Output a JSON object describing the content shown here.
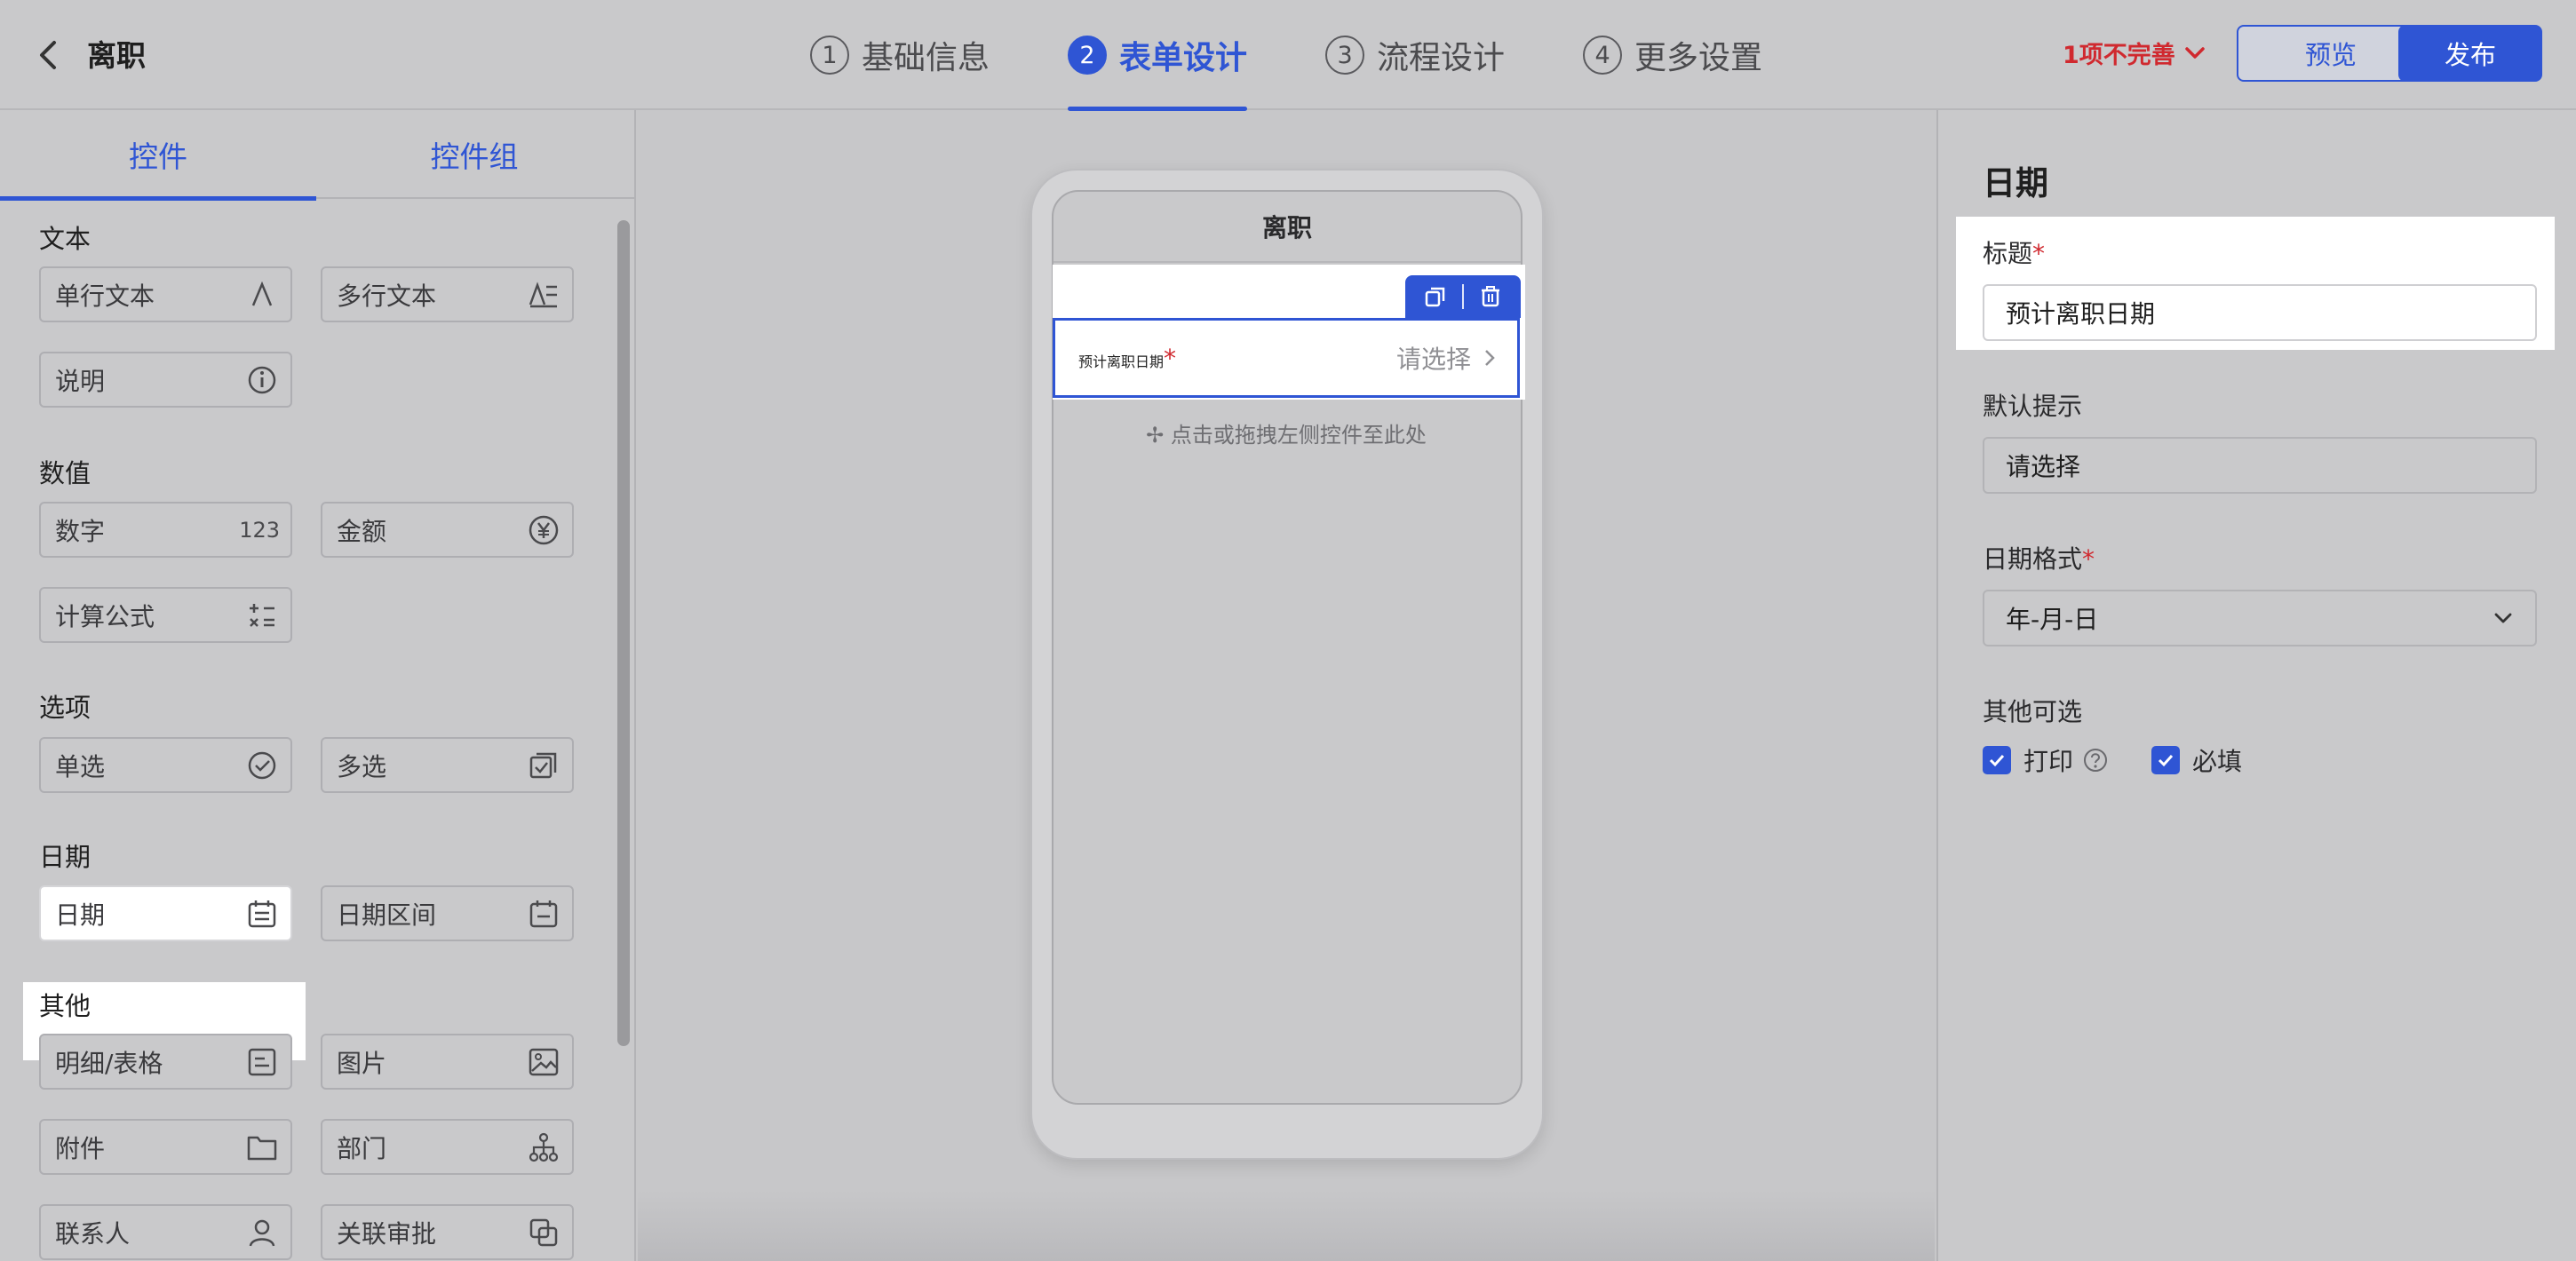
{
  "header": {
    "title": "离职",
    "steps": [
      {
        "num": "1",
        "label": "基础信息"
      },
      {
        "num": "2",
        "label": "表单设计"
      },
      {
        "num": "3",
        "label": "流程设计"
      },
      {
        "num": "4",
        "label": "更多设置"
      }
    ],
    "incomplete": "1项不完善",
    "preview_label": "预览",
    "publish_label": "发布"
  },
  "left_panel": {
    "tabs": [
      "控件",
      "控件组"
    ],
    "groups": {
      "text": "文本",
      "number": "数值",
      "option": "选项",
      "date": "日期",
      "other": "其他"
    },
    "controls": {
      "single_line": "单行文本",
      "multi_line": "多行文本",
      "note": "说明",
      "number": "数字",
      "number_icon_text": "123",
      "amount": "金额",
      "formula": "计算公式",
      "single_select": "单选",
      "multi_select": "多选",
      "date": "日期",
      "date_range": "日期区间",
      "detail_table": "明细/表格",
      "image": "图片",
      "attachment": "附件",
      "department": "部门",
      "contact": "联系人",
      "related_approval": "关联审批"
    }
  },
  "canvas": {
    "form_title": "离职",
    "field_label": "预计离职日期",
    "required_mark": "*",
    "field_placeholder": "请选择",
    "drop_hint": "点击或拖拽左侧控件至此处"
  },
  "right_panel": {
    "title": "日期",
    "label_title": "标题",
    "title_value": "预计离职日期",
    "label_default_hint": "默认提示",
    "default_hint_value": "请选择",
    "label_date_format": "日期格式",
    "date_format_value": "年-月-日",
    "label_other": "其他可选",
    "print_label": "打印",
    "required_label": "必填"
  },
  "colors": {
    "accent": "#2f55d4",
    "required": "#d0292f"
  }
}
